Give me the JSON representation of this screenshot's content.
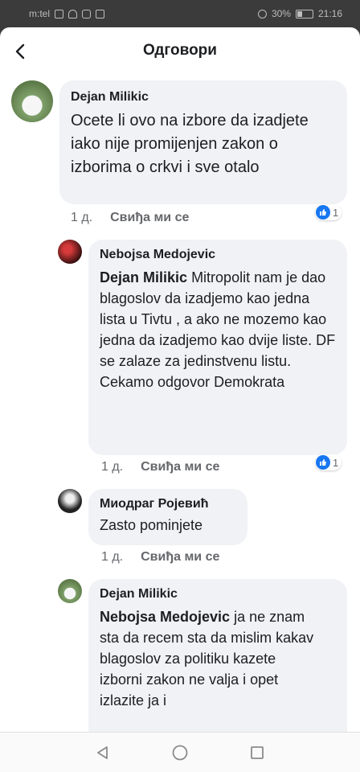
{
  "statusbar": {
    "carrier": "m:tel",
    "battery": "30%",
    "time": "21:16"
  },
  "header": {
    "title": "Одговори"
  },
  "comments": [
    {
      "author": "Dejan Milikic",
      "mention": "",
      "text": "Ocete li ovo na izbore da izadjete iako nije promijenjen zakon o izborima o crkvi i sve otalo",
      "time": "1 д.",
      "like_label": "Свиђа ми се",
      "reactions": "1"
    },
    {
      "author": "Nebojsa Medojevic",
      "mention": "Dejan Milikic",
      "text": "Mitropolit nam je dao blagoslov da izadjemo kao jedna lista u Tivtu , a ako ne mozemo kao jedna da izadjemo kao dvije liste. DF se zalaze za jedinstvenu listu. Cekamo odgovor Demokrata",
      "time": "1 д.",
      "like_label": "Свиђа ми се",
      "reactions": "1"
    },
    {
      "author": "Миодраг Ројевић",
      "mention": "",
      "text": "Zasto pominjete",
      "time": "1 д.",
      "like_label": "Свиђа ми се",
      "reactions": ""
    },
    {
      "author": "Dejan Milikic",
      "mention": "Nebojsa Medojevic",
      "text": "ja ne znam sta da recem sta da mislim kakav blagoslov za politiku kazete izborni zakon ne valja i opet izlazite ja i",
      "time": "",
      "like_label": "",
      "reactions": ""
    }
  ],
  "colors": {
    "accent": "#1877f2",
    "bubble": "#f0f2f5",
    "text": "#1c1e21",
    "meta": "#65676b"
  },
  "icons": {
    "back": "back-arrow-icon",
    "like": "thumbs-up-icon",
    "nav_back": "triangle-back-icon",
    "nav_home": "circle-home-icon",
    "nav_recents": "square-recents-icon"
  }
}
